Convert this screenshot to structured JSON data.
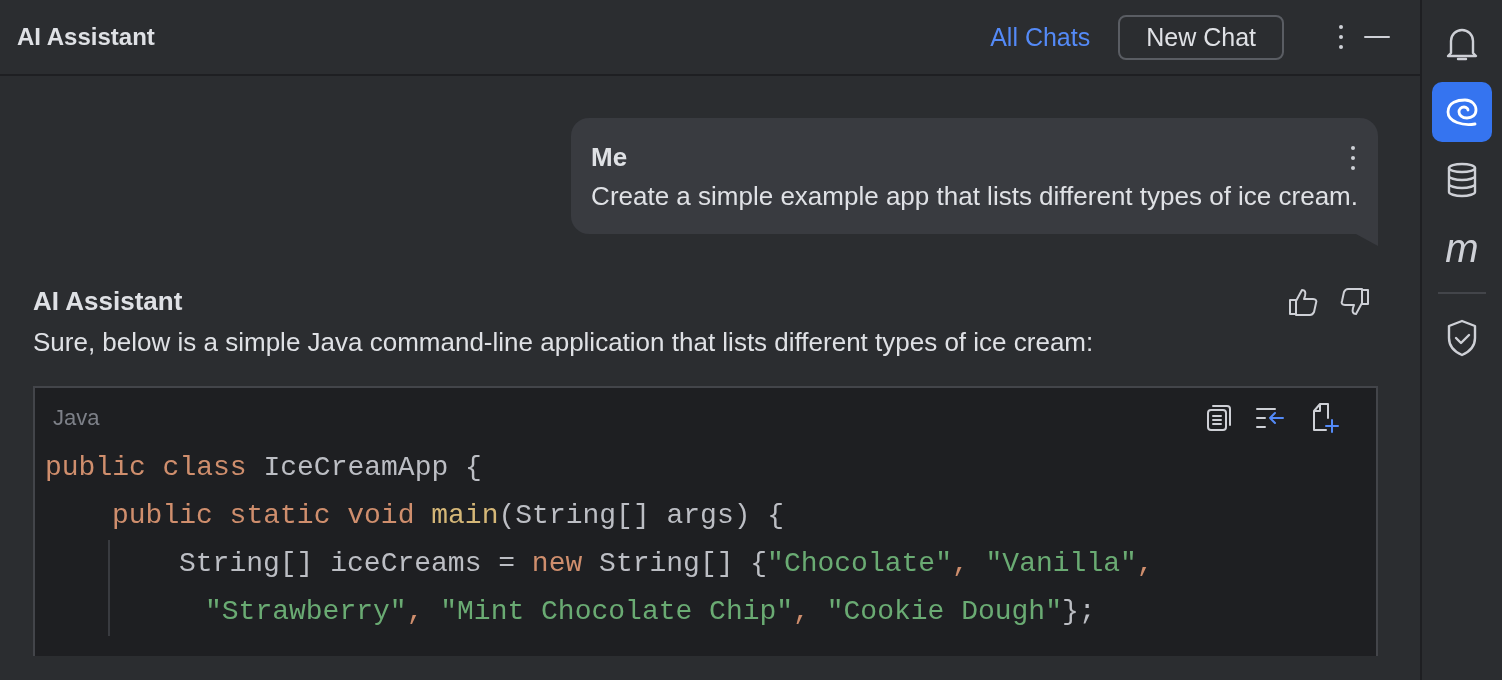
{
  "header": {
    "title": "AI Assistant",
    "all_chats": "All Chats",
    "new_chat": "New Chat"
  },
  "messages": [
    {
      "kind": "user",
      "author": "Me",
      "text": "Create a simple example app that lists different types of ice cream."
    },
    {
      "kind": "assistant",
      "author": "AI Assistant",
      "text": "Sure, below is a simple Java command-line application that lists different types of ice cream:",
      "code": {
        "language": "Java",
        "lines": [
          {
            "kind": "class",
            "tokens": [
              {
                "kind": "keyword",
                "text": "public class "
              },
              {
                "kind": "plain",
                "text": "IceCreamApp {"
              }
            ]
          },
          {
            "kind": "method",
            "tokens": [
              {
                "kind": "keyword",
                "text": "public static void "
              },
              {
                "kind": "function",
                "text": "main"
              },
              {
                "kind": "plain",
                "text": "(String[] args) {"
              }
            ]
          },
          {
            "kind": "statement",
            "tokens": [
              {
                "kind": "plain",
                "text": "String[] iceCreams = "
              },
              {
                "kind": "keyword",
                "text": "new "
              },
              {
                "kind": "plain",
                "text": "String[] {"
              },
              {
                "kind": "string",
                "text": "\"Chocolate\""
              },
              {
                "kind": "keyword",
                "text": ", "
              },
              {
                "kind": "string",
                "text": "\"Vanilla\""
              },
              {
                "kind": "keyword",
                "text": ","
              }
            ]
          },
          {
            "kind": "continuation",
            "tokens": [
              {
                "kind": "string",
                "text": "\"Strawberry\""
              },
              {
                "kind": "keyword",
                "text": ", "
              },
              {
                "kind": "string",
                "text": "\"Mint Chocolate Chip\""
              },
              {
                "kind": "keyword",
                "text": ", "
              },
              {
                "kind": "string",
                "text": "\"Cookie Dough\""
              },
              {
                "kind": "plain",
                "text": "};"
              }
            ]
          }
        ]
      }
    }
  ],
  "sidebar": [
    {
      "kind": "bell",
      "selected": false
    },
    {
      "kind": "spiral",
      "selected": true
    },
    {
      "kind": "database",
      "selected": false
    },
    {
      "kind": "letter",
      "glyph": "m",
      "selected": false
    },
    {
      "kind": "divider"
    },
    {
      "kind": "shield",
      "selected": false
    }
  ]
}
